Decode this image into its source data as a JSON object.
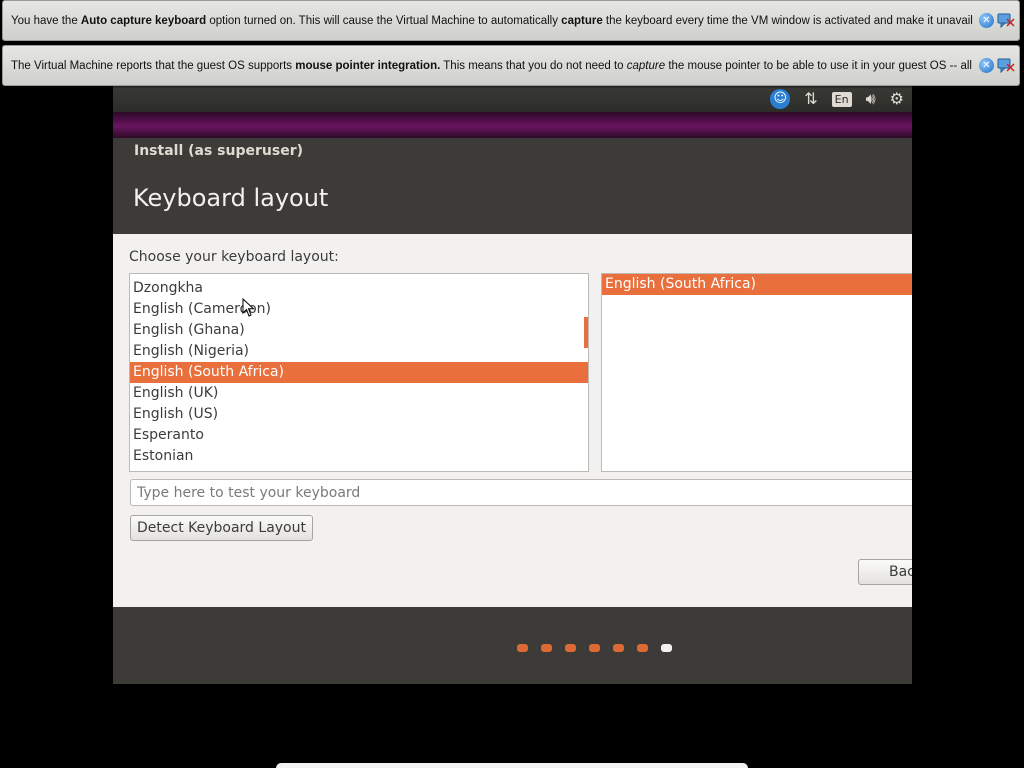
{
  "notifications": [
    {
      "segments": [
        {
          "text": "You have the ",
          "style": "normal"
        },
        {
          "text": "Auto capture keyboard",
          "style": "bold"
        },
        {
          "text": " option turned on. This will cause the Virtual Machine to automatically ",
          "style": "normal"
        },
        {
          "text": "capture",
          "style": "bold"
        },
        {
          "text": " the keyboard every time the VM window is activated and make it unavailable to",
          "style": "normal"
        }
      ]
    },
    {
      "segments": [
        {
          "text": "The Virtual Machine reports that the guest OS supports ",
          "style": "normal"
        },
        {
          "text": "mouse pointer integration.",
          "style": "bold"
        },
        {
          "text": " This means that you do not need to ",
          "style": "normal"
        },
        {
          "text": "capture",
          "style": "italic"
        },
        {
          "text": " the mouse pointer to be able to use it in your guest OS -- all mouse",
          "style": "normal"
        }
      ]
    }
  ],
  "top_panel": {
    "icons": [
      "accessibility-icon",
      "network-icon",
      "keyboard-language-icon",
      "volume-icon",
      "settings-gear-icon"
    ],
    "language": "En"
  },
  "window": {
    "title": "Install (as superuser)",
    "heading": "Keyboard layout"
  },
  "content": {
    "choose_label": "Choose your keyboard layout:",
    "layouts": [
      "Dzongkha",
      "English (Cameroon)",
      "English (Ghana)",
      "English (Nigeria)",
      "English (South Africa)",
      "English (UK)",
      "English (US)",
      "Esperanto",
      "Estonian"
    ],
    "selected_layout_index": 4,
    "variants": [
      "English (South Africa)"
    ],
    "selected_variant_index": 0,
    "test_placeholder": "Type here to test your keyboard",
    "detect_button": "Detect Keyboard Layout",
    "back_button": "Back"
  },
  "progress": {
    "total_steps": 7,
    "current_step": 7
  },
  "colors": {
    "accent": "#e96f3c",
    "dot_done": "#dd6a35",
    "dot_current": "#f2f1f0"
  }
}
